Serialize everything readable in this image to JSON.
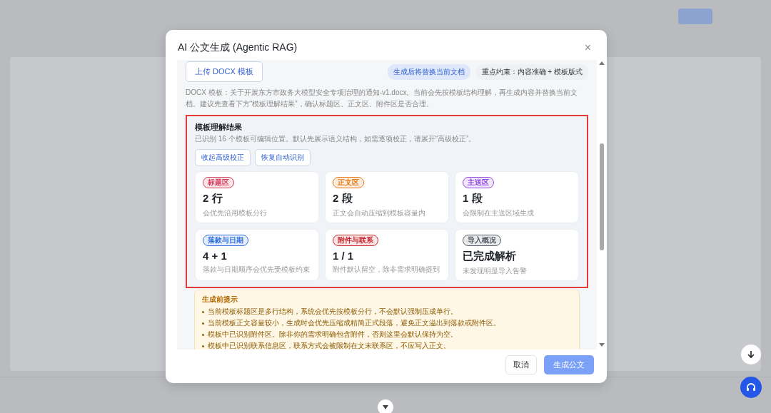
{
  "dialog": {
    "title": "AI 公文生成 (Agentic RAG)",
    "close": "×"
  },
  "upload_button": "上传 DOCX 模板",
  "chips": [
    {
      "text": "生成后将替换当前文档",
      "kind": "info"
    },
    {
      "text": "重点约束：内容准确 + 模板版式",
      "kind": "plain"
    }
  ],
  "description": "DOCX 模板：关于开展东方市政务大模型安全专项治理的通知-v1.docx。当前会先按模板结构理解，再生成内容并替换当前文档。建议先查看下方“模板理解结果”，确认标题区、正文区、附件区是否合理。",
  "analysis": {
    "title": "模板理解结果",
    "subtitle": "已识别 16 个模板可编辑位置。默认先展示语义结构，如需逐项校正，请展开“高级校正”。",
    "highlighted": true,
    "actions": [
      "收起高级校正",
      "恢复自动识别"
    ],
    "cards": [
      {
        "tag": "标题区",
        "color": "#d63c5a",
        "value": "2 行",
        "note": "会优先沿用模板分行"
      },
      {
        "tag": "正文区",
        "color": "#e8750c",
        "value": "2 段",
        "note": "正文会自动压缩到模板容量内"
      },
      {
        "tag": "主送区",
        "color": "#8e44e0",
        "value": "1 段",
        "note": "会限制在主送区域生成"
      },
      {
        "tag": "落款与日期",
        "color": "#2f6fe0",
        "value": "4 + 1",
        "note": "落款与日期顺序会优先受模板约束"
      },
      {
        "tag": "附件与联系",
        "color": "#c8282e",
        "value": "1 / 1",
        "note": "附件默认留空，除非需求明确提到"
      },
      {
        "tag": "导入概况",
        "color": "#555b66",
        "value": "已完成解析",
        "note": "未发现明显导入告警"
      }
    ]
  },
  "tips": {
    "title": "生成前提示",
    "items": [
      "当前模板标题区是多行结构，系统会优先按模板分行，不会默认强制压成单行。",
      "当前模板正文容量较小，生成时会优先压缩成精简正式段落，避免正文溢出到落款或附件区。",
      "模板中已识别附件区。除非你的需求明确包含附件，否则这里会默认保持为空。",
      "模板中已识别联系信息区，联系方式会被限制在文末联系区，不应写入正文。"
    ]
  },
  "footer": {
    "cancel": "取消",
    "submit": {
      "label": "生成公文",
      "disabled": true
    }
  }
}
